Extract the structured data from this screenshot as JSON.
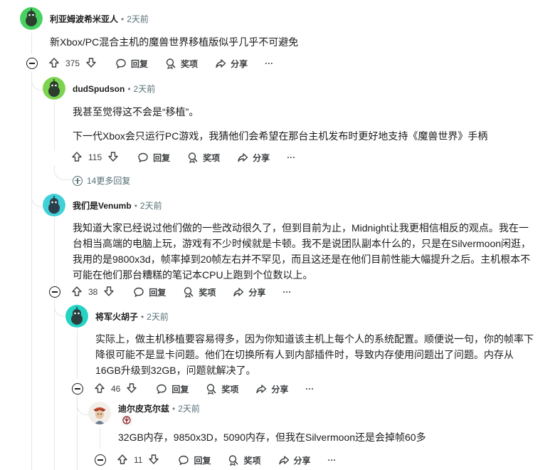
{
  "icons": {
    "upvote": "arrow-up-icon",
    "downvote": "arrow-down-icon",
    "reply": "speech-bubble-icon",
    "award": "award-icon",
    "share": "share-arrow-icon",
    "more": "ellipsis-icon",
    "collapse": "minus-circle-icon",
    "expand": "plus-circle-icon"
  },
  "colors": {
    "avatar_green": "#46d160",
    "avatar_teal": "#24d3c2",
    "avatar_cyan": "#3fd0d8",
    "time_gray": "#576f76"
  },
  "comments": [
    {
      "username": "利亚姆波希米亚人",
      "time": "2天前",
      "lines": [
        "新Xbox/PC混合主机的魔兽世界移植版似乎几乎不可避免"
      ],
      "votes": "375",
      "reply_label": "回复",
      "award_label": "奖项",
      "share_label": "分享",
      "more_label": "···"
    },
    {
      "username": "dudSpudson",
      "time": "2天前",
      "lines": [
        "我甚至觉得这不会是“移植”。",
        "下一代Xbox会只运行PC游戏，我猜他们会希望在那台主机发布时更好地支持《魔兽世界》手柄"
      ],
      "votes": "115",
      "reply_label": "回复",
      "award_label": "奖项",
      "share_label": "分享",
      "more_label": "···",
      "more_replies": "14更多回复"
    },
    {
      "username": "我们是Venumb",
      "time": "2天前",
      "lines": [
        "我知道大家已经说过他们做的一些改动很久了，但到目前为止，Midnight让我更相信相反的观点。我在一台相当高端的电脑上玩，游戏有不少时候就是卡顿。我不是说团队副本什么的，只是在Silvermoon闲逛，我用的是9800x3d，帧率掉到20帧左右并不罕见，而且这还是在他们目前性能大幅提升之后。主机根本不可能在他们那台糟糕的笔记本CPU上跑到个位数以上。"
      ],
      "votes": "38",
      "reply_label": "回复",
      "award_label": "奖项",
      "share_label": "分享",
      "more_label": "···"
    },
    {
      "username": "将军火胡子",
      "time": "2天前",
      "lines": [
        "实际上，做主机移植要容易得多，因为你知道该主机上每个人的系统配置。顺便说一句，你的帧率下降很可能不是显卡问题。他们在切换所有人到内部插件时，导致内存使用问题出了问题。内存从16GB升级到32GB，问题就解决了。"
      ],
      "votes": "46",
      "reply_label": "回复",
      "award_label": "奖项",
      "share_label": "分享",
      "more_label": "···"
    },
    {
      "username": "迪尔皮克尔兹",
      "time": "2天前",
      "lines": [
        "32GB内存，9850x3D，5090内存，但我在Silvermoon还是会掉帧60多"
      ],
      "votes": "11",
      "reply_label": "回复",
      "award_label": "奖项",
      "share_label": "分享",
      "more_label": "···",
      "flair_icon": "horde-emblem-icon"
    }
  ]
}
